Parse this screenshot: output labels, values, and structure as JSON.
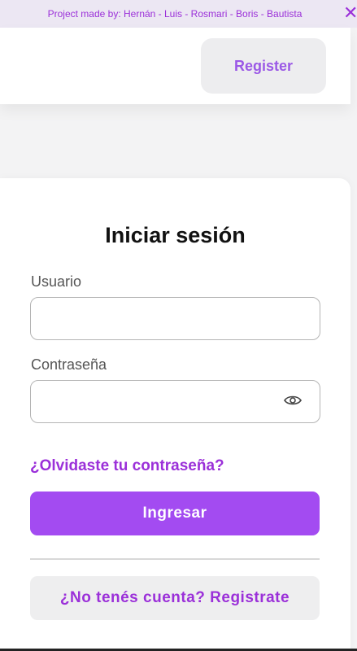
{
  "banner": {
    "text": "Project made by: Hernán - Luis - Rosmari - Boris - Bautista",
    "close_glyph": "✕"
  },
  "header": {
    "register_label": "Register"
  },
  "login": {
    "title": "Iniciar sesión",
    "username_label": "Usuario",
    "username_value": "",
    "password_label": "Contraseña",
    "password_value": "",
    "show_password_icon": "eye-icon",
    "forgot_link": "¿Olvidaste tu contraseña?",
    "submit_label": "Ingresar",
    "signup_label": "¿No tenés cuenta? Registrate"
  },
  "colors": {
    "accent": "#a34bf1",
    "accent_text": "#9b30d9",
    "banner_bg": "#ece7f3",
    "secondary_button_bg": "#eeeeef"
  }
}
